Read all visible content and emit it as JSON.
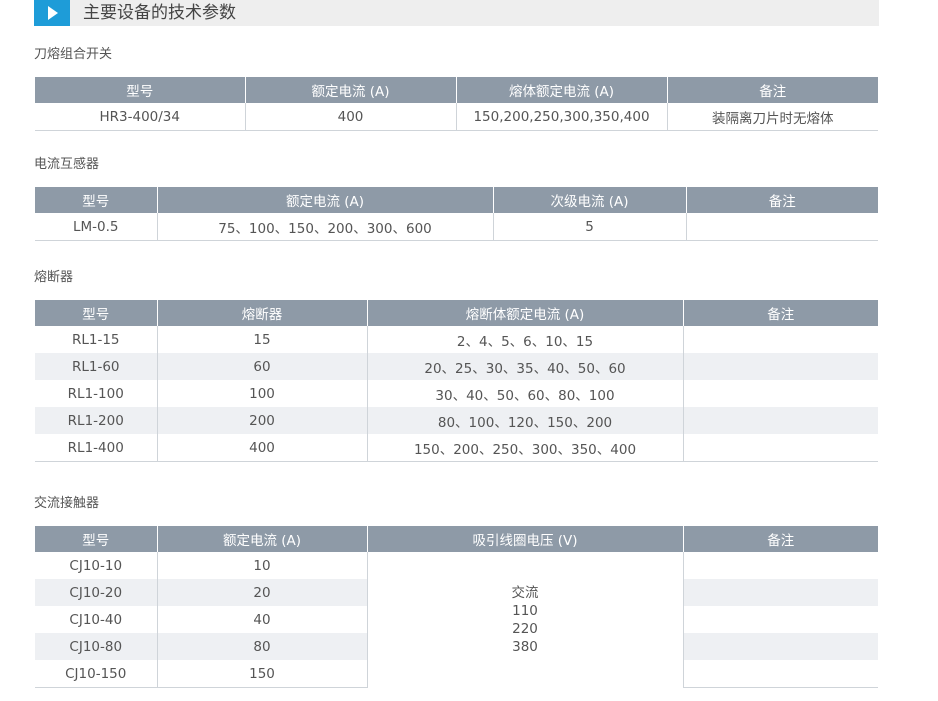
{
  "header": {
    "title": "主要设备的技术参数",
    "accent": "#1e9cd8"
  },
  "sections": [
    {
      "title": "刀熔组合开关",
      "columns": [
        "型号",
        "额定电流 (A)",
        "熔体额定电流 (A)",
        "备注"
      ],
      "rows": [
        [
          "HR3-400/34",
          "400",
          "150,200,250,300,350,400",
          "装隔离刀片时无熔体"
        ]
      ]
    },
    {
      "title": "电流互感器",
      "columns": [
        "型号",
        "额定电流 (A)",
        "次级电流 (A)",
        "备注"
      ],
      "rows": [
        [
          "LM-0.5",
          "75、100、150、200、300、600",
          "5",
          ""
        ]
      ]
    },
    {
      "title": "熔断器",
      "columns": [
        "型号",
        "熔断器",
        "熔断体额定电流 (A)",
        "备注"
      ],
      "rows": [
        [
          "RL1-15",
          "15",
          "2、4、5、6、10、15",
          ""
        ],
        [
          "RL1-60",
          "60",
          "20、25、30、35、40、50、60",
          ""
        ],
        [
          "RL1-100",
          "100",
          "30、40、50、60、80、100",
          ""
        ],
        [
          "RL1-200",
          "200",
          "80、100、120、150、200",
          ""
        ],
        [
          "RL1-400",
          "400",
          "150、200、250、300、350、400",
          ""
        ]
      ]
    },
    {
      "title": "交流接触器",
      "columns": [
        "型号",
        "额定电流 (A)",
        "吸引线圈电压 (V)",
        "备注"
      ],
      "rows": [
        [
          "CJ10-10",
          "10"
        ],
        [
          "CJ10-20",
          "20"
        ],
        [
          "CJ10-40",
          "40"
        ],
        [
          "CJ10-80",
          "80"
        ],
        [
          "CJ10-150",
          "150"
        ]
      ],
      "voltage": [
        "交流",
        "110",
        "220",
        "380"
      ]
    }
  ],
  "colors": {
    "table_header": "#8e9aa7",
    "row_alt": "#eef0f3",
    "border": "#cfd4d9"
  }
}
